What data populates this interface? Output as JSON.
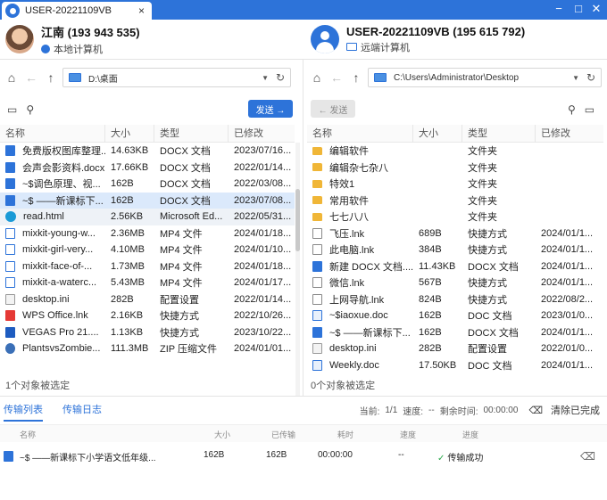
{
  "titlebar": {
    "tab_title": "USER-20221109VB",
    "close": "×",
    "min": "−",
    "max": "□",
    "close_win": "✕",
    "accent": "#2d73d9"
  },
  "left": {
    "name": "江南 (193 943 535)",
    "sub": "本地计算机",
    "path": "D:\\桌面",
    "send_label": "发送 →",
    "columns": [
      "名称",
      "大小",
      "类型",
      "已修改"
    ],
    "rows": [
      {
        "name": "免费版权图库整理...",
        "size": "14.63KB",
        "type": "DOCX 文档",
        "date": "2023/07/16...",
        "icon": "docx"
      },
      {
        "name": "会声会影资料.docx",
        "size": "17.66KB",
        "type": "DOCX 文档",
        "date": "2022/01/14...",
        "icon": "docx"
      },
      {
        "name": "~$调色原理、视...",
        "size": "162B",
        "type": "DOCX 文档",
        "date": "2022/03/08...",
        "icon": "docx"
      },
      {
        "name": "~$ ——新课标下...",
        "size": "162B",
        "type": "DOCX 文档",
        "date": "2023/07/08...",
        "icon": "docx",
        "state": "sel"
      },
      {
        "name": "read.html",
        "size": "2.56KB",
        "type": "Microsoft Ed...",
        "date": "2022/05/31...",
        "icon": "html",
        "state": "hov"
      },
      {
        "name": "mixkit-young-w...",
        "size": "2.36MB",
        "type": "MP4 文件",
        "date": "2024/01/18...",
        "icon": "mp4"
      },
      {
        "name": "mixkit-girl-very...",
        "size": "4.10MB",
        "type": "MP4 文件",
        "date": "2024/01/10...",
        "icon": "mp4"
      },
      {
        "name": "mixkit-face-of-...",
        "size": "1.73MB",
        "type": "MP4 文件",
        "date": "2024/01/18...",
        "icon": "mp4"
      },
      {
        "name": "mixkit-a-waterc...",
        "size": "5.43MB",
        "type": "MP4 文件",
        "date": "2024/01/17...",
        "icon": "mp4"
      },
      {
        "name": "desktop.ini",
        "size": "282B",
        "type": "配置设置",
        "date": "2022/01/14...",
        "icon": "ini"
      },
      {
        "name": "WPS Office.lnk",
        "size": "2.16KB",
        "type": "快捷方式",
        "date": "2022/10/26...",
        "icon": "wps"
      },
      {
        "name": "VEGAS Pro 21....",
        "size": "1.13KB",
        "type": "快捷方式",
        "date": "2023/10/22...",
        "icon": "vegas"
      },
      {
        "name": "PlantsvsZombie...",
        "size": "111.3MB",
        "type": "ZIP 压缩文件",
        "date": "2024/01/01...",
        "icon": "zip"
      }
    ],
    "status": "1个对象被选定"
  },
  "right": {
    "name": "USER-20221109VB (195 615 792)",
    "sub": "远端计算机",
    "path": "C:\\Users\\Administrator\\Desktop",
    "send_label": "← 发送",
    "columns": [
      "名称",
      "大小",
      "类型",
      "已修改"
    ],
    "rows": [
      {
        "name": "编辑软件",
        "size": "",
        "type": "文件夹",
        "date": "",
        "icon": "folder"
      },
      {
        "name": "编辑杂七杂八",
        "size": "",
        "type": "文件夹",
        "date": "",
        "icon": "folder"
      },
      {
        "name": "特效1",
        "size": "",
        "type": "文件夹",
        "date": "",
        "icon": "folder"
      },
      {
        "name": "常用软件",
        "size": "",
        "type": "文件夹",
        "date": "",
        "icon": "folder"
      },
      {
        "name": "七七八八",
        "size": "",
        "type": "文件夹",
        "date": "",
        "icon": "folder"
      },
      {
        "name": "飞压.lnk",
        "size": "689B",
        "type": "快捷方式",
        "date": "2024/01/1...",
        "icon": "lnk"
      },
      {
        "name": "此电脑.lnk",
        "size": "384B",
        "type": "快捷方式",
        "date": "2024/01/1...",
        "icon": "lnk"
      },
      {
        "name": "新建 DOCX 文档....",
        "size": "11.43KB",
        "type": "DOCX 文档",
        "date": "2024/01/1...",
        "icon": "docx"
      },
      {
        "name": "微信.lnk",
        "size": "567B",
        "type": "快捷方式",
        "date": "2024/01/1...",
        "icon": "lnk"
      },
      {
        "name": "上网导航.lnk",
        "size": "824B",
        "type": "快捷方式",
        "date": "2022/08/2...",
        "icon": "lnk"
      },
      {
        "name": "~$iaoxue.doc",
        "size": "162B",
        "type": "DOC 文档",
        "date": "2023/01/0...",
        "icon": "doc"
      },
      {
        "name": "~$ ——新课标下...",
        "size": "162B",
        "type": "DOCX 文档",
        "date": "2024/01/1...",
        "icon": "docx"
      },
      {
        "name": "desktop.ini",
        "size": "282B",
        "type": "配置设置",
        "date": "2022/01/0...",
        "icon": "ini"
      },
      {
        "name": "Weekly.doc",
        "size": "17.50KB",
        "type": "DOC 文档",
        "date": "2024/01/1...",
        "icon": "doc"
      }
    ],
    "status": "0个对象被选定"
  },
  "transfer": {
    "tab_list": "传输列表",
    "tab_log": "传输日志",
    "current_label": "当前:",
    "current": "1/1",
    "speed_label": "速度:",
    "speed": "--",
    "remaining_label": "剩余时间:",
    "remaining": "00:00:00",
    "clear": "清除已完成",
    "columns": [
      "名称",
      "大小",
      "已传输",
      "耗时",
      "速度",
      "进度"
    ],
    "row": {
      "name": "~$ ——新课标下小学语文低年级...",
      "size": "162B",
      "transferred": "162B",
      "time": "00:00:00",
      "speed": "--",
      "progress": "传输成功"
    }
  }
}
